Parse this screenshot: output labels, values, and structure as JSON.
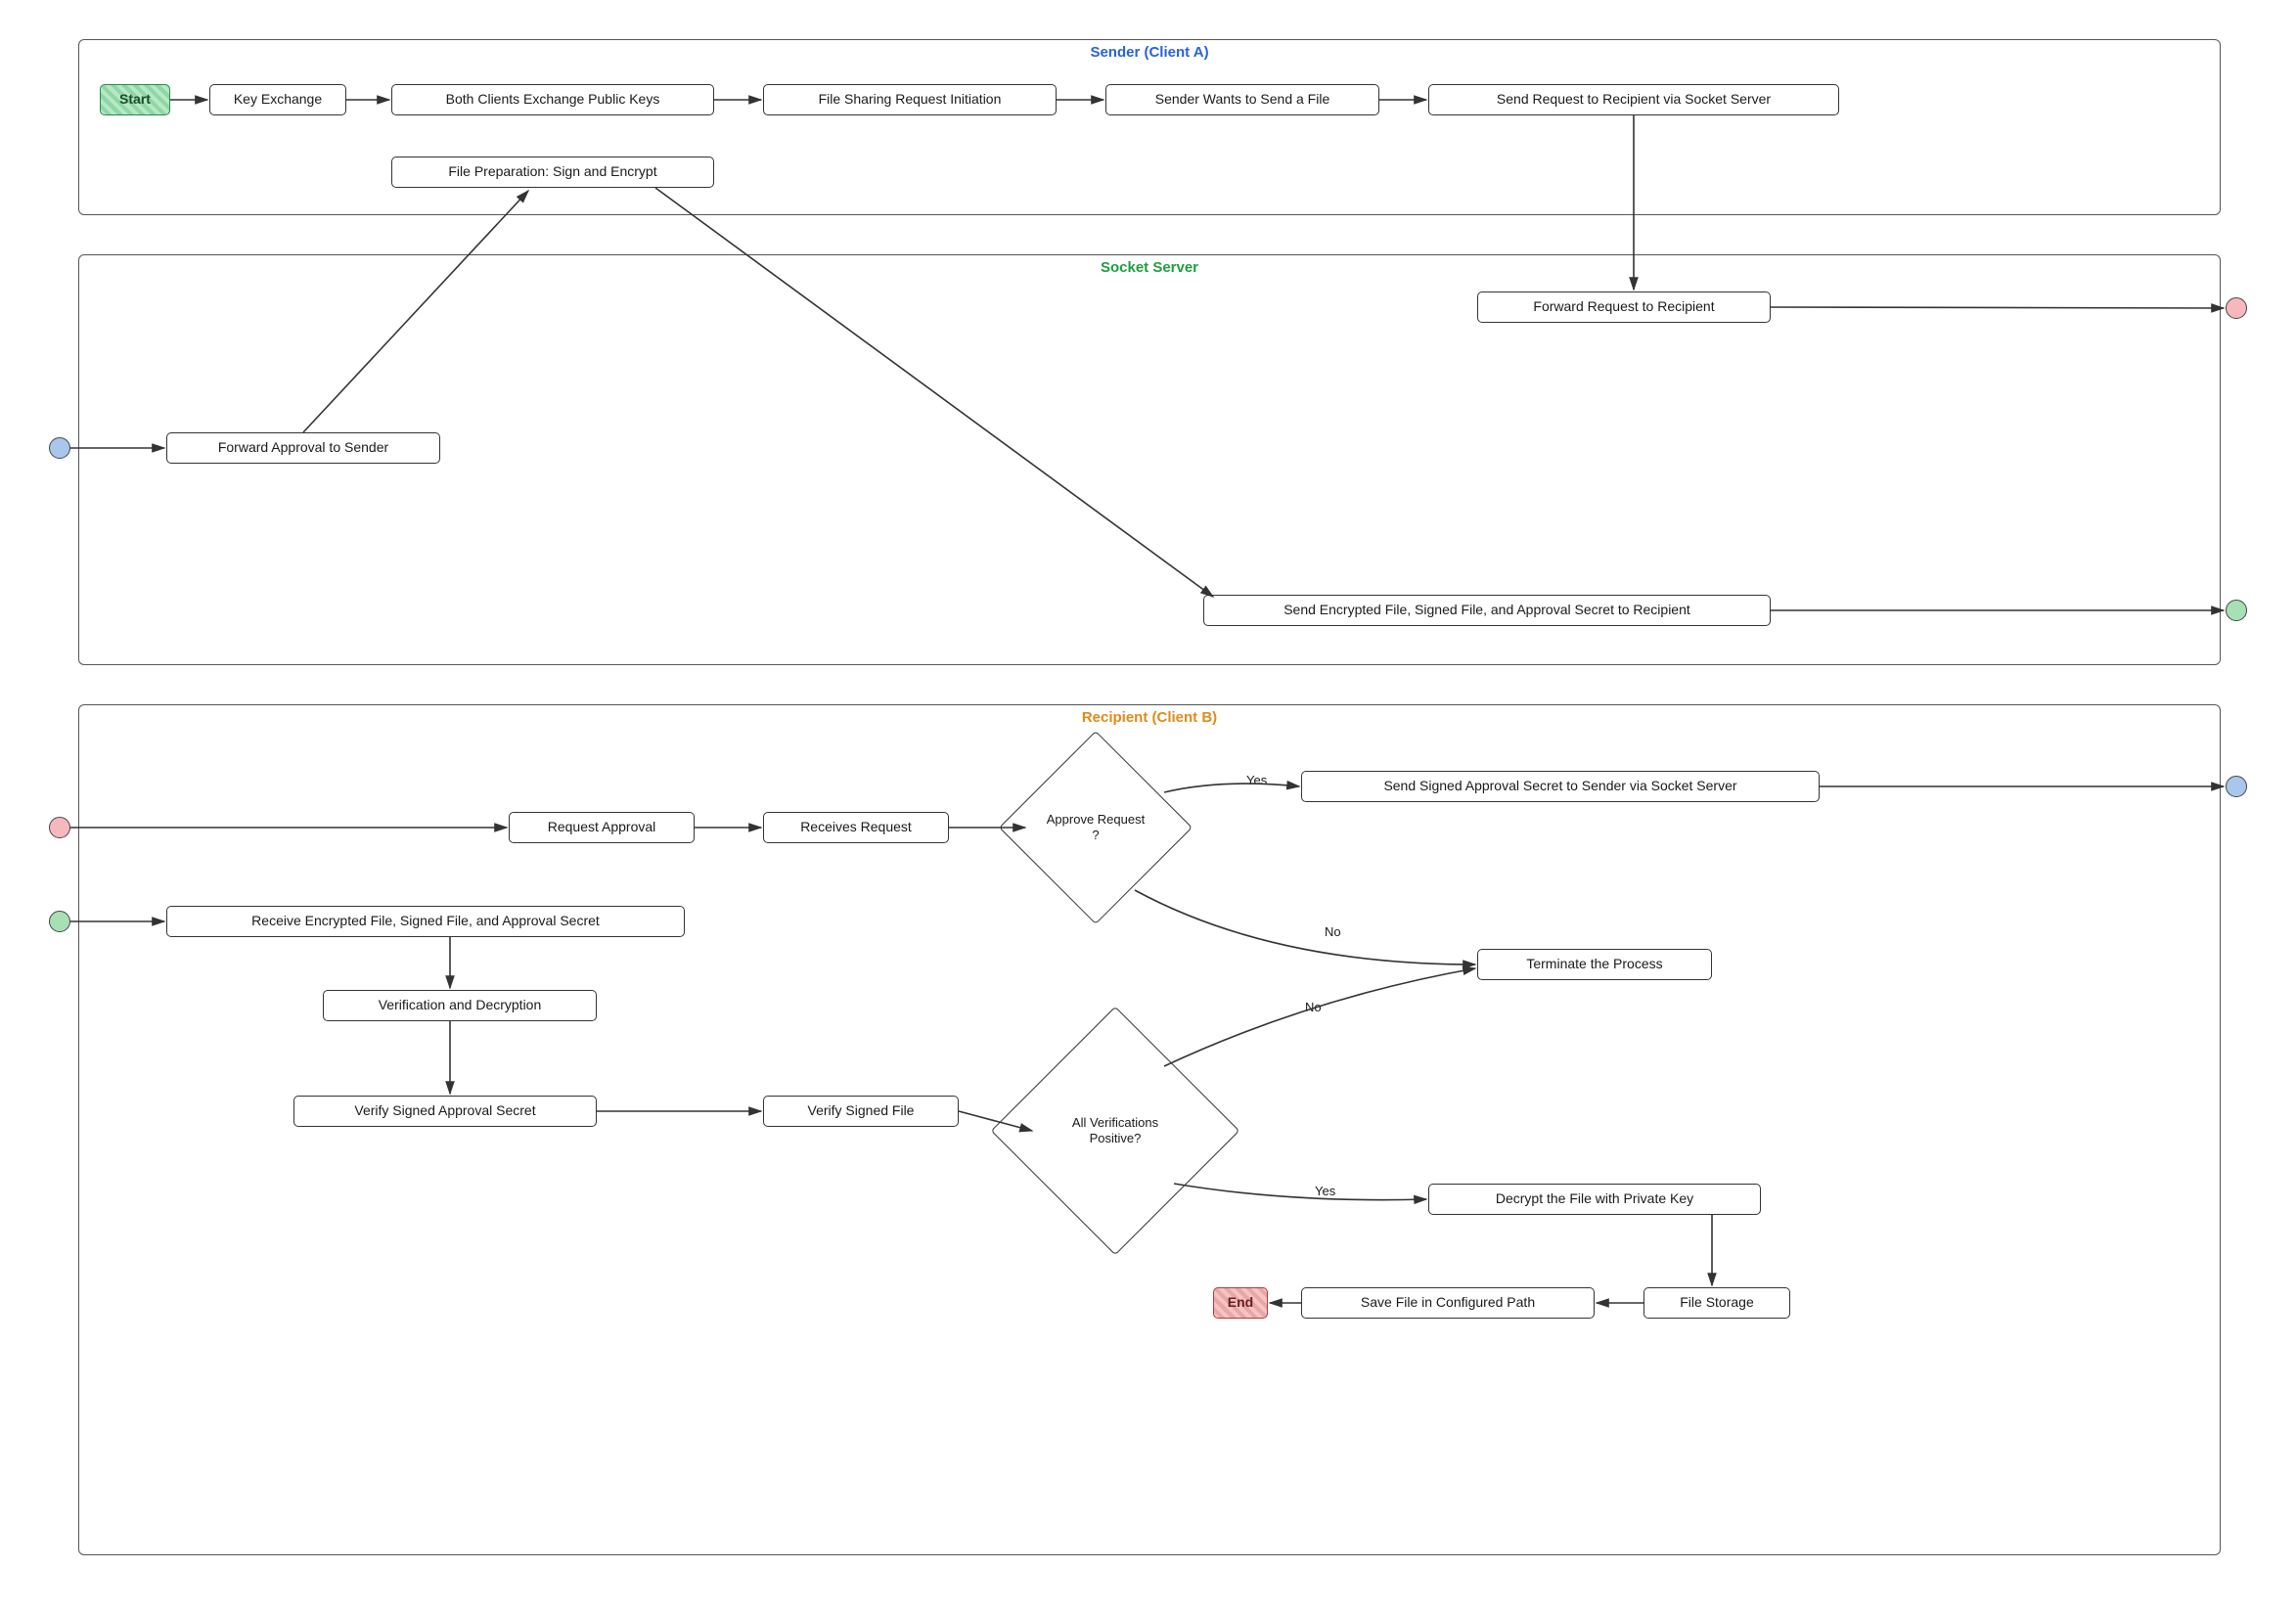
{
  "lanes": {
    "sender": {
      "title": "Sender (Client A)"
    },
    "server": {
      "title": "Socket Server"
    },
    "recipient": {
      "title": "Recipient (Client B)"
    }
  },
  "nodes": {
    "start": "Start",
    "keyExchange": "Key Exchange",
    "exchangeKeys": "Both Clients Exchange Public Keys",
    "fileShareInit": "File Sharing Request Initiation",
    "senderWants": "Sender Wants to Send a File",
    "sendRequest": "Send Request to Recipient via Socket Server",
    "filePrep": "File Preparation: Sign and Encrypt",
    "forwardReq": "Forward Request to Recipient",
    "forwardApproval": "Forward Approval to Sender",
    "sendEncrypted": "Send Encrypted File, Signed File, and Approval Secret to Recipient",
    "requestApproval": "Request Approval",
    "receivesRequest": "Receives Request",
    "approveQ": "Approve Request ?",
    "sendSignedApproval": "Send Signed Approval Secret to Sender via Socket Server",
    "terminate": "Terminate the Process",
    "receiveEncrypted": "Receive Encrypted File, Signed File, and Approval Secret",
    "verifAndDecrypt": "Verification and Decryption",
    "verifySignedSecret": "Verify Signed Approval Secret",
    "verifySignedFile": "Verify Signed File",
    "allVerifQ": "All Verifications Positive?",
    "decryptFile": "Decrypt the File with Private Key",
    "fileStorage": "File Storage",
    "saveFile": "Save File in Configured Path",
    "end": "End"
  },
  "edgeLabels": {
    "yes1": "Yes",
    "no1": "No",
    "yes2": "Yes",
    "no2": "No"
  },
  "portColors": {
    "server_out_top": "pink",
    "server_in_left": "blue",
    "server_out_bottom": "green",
    "recipient_in_top": "pink",
    "recipient_out_top": "blue",
    "recipient_in_bottom": "green"
  }
}
